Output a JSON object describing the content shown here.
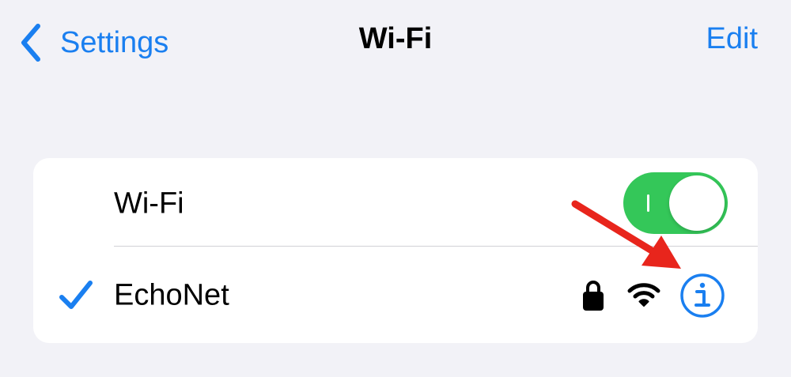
{
  "nav": {
    "back_label": "Settings",
    "title": "Wi-Fi",
    "edit_label": "Edit"
  },
  "wifi_row": {
    "label": "Wi-Fi",
    "toggle_on": true
  },
  "network_row": {
    "name": "EchoNet",
    "connected": true,
    "secured": true,
    "signal": "full"
  },
  "icons": {
    "back": "chevron-left-icon",
    "check": "checkmark-icon",
    "lock": "lock-icon",
    "wifi": "wifi-signal-icon",
    "info": "info-icon"
  },
  "colors": {
    "background": "#f2f2f7",
    "accent": "#1a7ff0",
    "toggle_on": "#34c759",
    "annotation": "#e8251c"
  }
}
